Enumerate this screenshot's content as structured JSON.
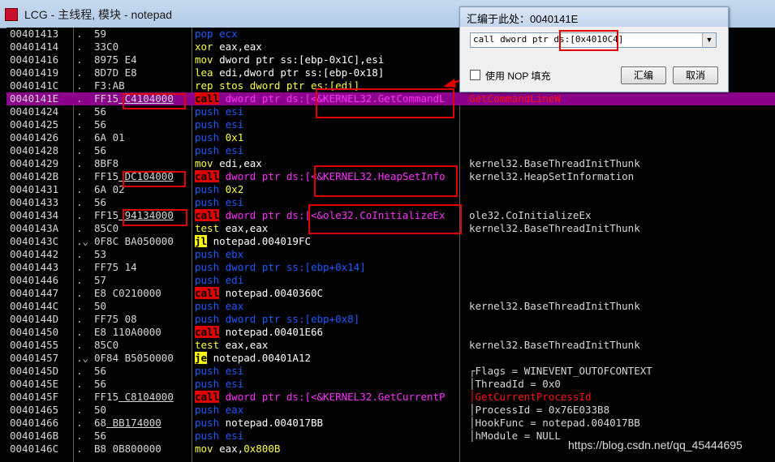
{
  "window": {
    "title": "LCG - 主线程, 模块 - notepad"
  },
  "rows": [
    {
      "addr": "00401413",
      "mark": ".",
      "hex": "59",
      "asm": [
        {
          "t": "pop ecx",
          "c": "k-blue"
        }
      ],
      "cmt": ""
    },
    {
      "addr": "00401414",
      "mark": ".",
      "hex": "33C0",
      "asm": [
        {
          "t": "xor ",
          "c": "k-yellow"
        },
        {
          "t": "eax,eax",
          "c": "k-white"
        }
      ],
      "cmt": ""
    },
    {
      "addr": "00401416",
      "mark": ".",
      "hex": "8975 E4",
      "asm": [
        {
          "t": "mov ",
          "c": "k-yellow"
        },
        {
          "t": "dword ptr ss:[ebp-0x1C],esi",
          "c": "k-white"
        }
      ],
      "cmt": ""
    },
    {
      "addr": "00401419",
      "mark": ".",
      "hex": "8D7D E8",
      "asm": [
        {
          "t": "lea ",
          "c": "k-yellow"
        },
        {
          "t": "edi,dword ptr ss:[ebp-0x18]",
          "c": "k-white"
        }
      ],
      "cmt": ""
    },
    {
      "addr": "0040141C",
      "mark": ".",
      "hex": "F3:AB",
      "asm": [
        {
          "t": "rep stos dword ptr es:[edi]",
          "c": "k-yellow"
        }
      ],
      "cmt": ""
    },
    {
      "addr": "0040141E",
      "mark": ".",
      "hex": "FF15 C4104000",
      "sel": true,
      "asm": [
        {
          "t": "call",
          "c": "k-call"
        },
        {
          "t": " dword ptr ds:[",
          "c": "k-mag"
        },
        {
          "t": "<&KERNEL32.GetCommandL",
          "c": "k-mag"
        }
      ],
      "cmt": "GetCommandLineW",
      "cmtc": "k-red"
    },
    {
      "addr": "00401424",
      "mark": ".",
      "hex": "56",
      "asm": [
        {
          "t": "push ",
          "c": "k-blue"
        },
        {
          "t": "esi",
          "c": "k-blue"
        }
      ],
      "cmt": ""
    },
    {
      "addr": "00401425",
      "mark": ".",
      "hex": "56",
      "asm": [
        {
          "t": "push ",
          "c": "k-blue"
        },
        {
          "t": "esi",
          "c": "k-blue"
        }
      ],
      "cmt": ""
    },
    {
      "addr": "00401426",
      "mark": ".",
      "hex": "6A 01",
      "asm": [
        {
          "t": "push ",
          "c": "k-blue"
        },
        {
          "t": "0x1",
          "c": "k-yellow"
        }
      ],
      "cmt": ""
    },
    {
      "addr": "00401428",
      "mark": ".",
      "hex": "56",
      "asm": [
        {
          "t": "push ",
          "c": "k-blue"
        },
        {
          "t": "esi",
          "c": "k-blue"
        }
      ],
      "cmt": ""
    },
    {
      "addr": "00401429",
      "mark": ".",
      "hex": "8BF8",
      "asm": [
        {
          "t": "mov ",
          "c": "k-yellow"
        },
        {
          "t": "edi,eax",
          "c": "k-white"
        }
      ],
      "cmt": "kernel32.BaseThreadInitThunk"
    },
    {
      "addr": "0040142B",
      "mark": ".",
      "hex": "FF15 DC104000",
      "asm": [
        {
          "t": "call",
          "c": "k-call"
        },
        {
          "t": " dword ptr ds:[",
          "c": "k-mag"
        },
        {
          "t": "<&KERNEL32.HeapSetInfo",
          "c": "k-mag"
        }
      ],
      "cmt": "kernel32.HeapSetInformation"
    },
    {
      "addr": "00401431",
      "mark": ".",
      "hex": "6A 02",
      "asm": [
        {
          "t": "push ",
          "c": "k-blue"
        },
        {
          "t": "0x2",
          "c": "k-yellow"
        }
      ],
      "cmt": ""
    },
    {
      "addr": "00401433",
      "mark": ".",
      "hex": "56",
      "asm": [
        {
          "t": "push ",
          "c": "k-blue"
        },
        {
          "t": "esi",
          "c": "k-blue"
        }
      ],
      "cmt": ""
    },
    {
      "addr": "00401434",
      "mark": ".",
      "hex": "FF15 94134000",
      "asm": [
        {
          "t": "call",
          "c": "k-call"
        },
        {
          "t": " dword ptr ds:[",
          "c": "k-mag"
        },
        {
          "t": "<&ole32.CoInitializeEx",
          "c": "k-mag"
        }
      ],
      "cmt": "ole32.CoInitializeEx"
    },
    {
      "addr": "0040143A",
      "mark": ".",
      "hex": "85C0",
      "asm": [
        {
          "t": "test ",
          "c": "k-yellow"
        },
        {
          "t": "eax,eax",
          "c": "k-white"
        }
      ],
      "cmt": "kernel32.BaseThreadInitThunk"
    },
    {
      "addr": "0040143C",
      "mark": ".⌄",
      "hex": "0F8C BA050000",
      "asm": [
        {
          "t": "jl",
          "c": "k-jmp"
        },
        {
          "t": " notepad.004019FC",
          "c": "k-white"
        }
      ],
      "cmt": ""
    },
    {
      "addr": "00401442",
      "mark": ".",
      "hex": "53",
      "asm": [
        {
          "t": "push ",
          "c": "k-blue"
        },
        {
          "t": "ebx",
          "c": "k-blue"
        }
      ],
      "cmt": ""
    },
    {
      "addr": "00401443",
      "mark": ".",
      "hex": "FF75 14",
      "asm": [
        {
          "t": "push ",
          "c": "k-blue"
        },
        {
          "t": "dword ptr ss:[ebp+0x14]",
          "c": "k-blue"
        }
      ],
      "cmt": ""
    },
    {
      "addr": "00401446",
      "mark": ".",
      "hex": "57",
      "asm": [
        {
          "t": "push ",
          "c": "k-blue"
        },
        {
          "t": "edi",
          "c": "k-blue"
        }
      ],
      "cmt": ""
    },
    {
      "addr": "00401447",
      "mark": ".",
      "hex": "E8 C0210000",
      "asm": [
        {
          "t": "call",
          "c": "k-call"
        },
        {
          "t": " notepad.0040360C",
          "c": "k-white"
        }
      ],
      "cmt": ""
    },
    {
      "addr": "0040144C",
      "mark": ".",
      "hex": "50",
      "asm": [
        {
          "t": "push ",
          "c": "k-blue"
        },
        {
          "t": "eax",
          "c": "k-blue"
        }
      ],
      "cmt": "kernel32.BaseThreadInitThunk"
    },
    {
      "addr": "0040144D",
      "mark": ".",
      "hex": "FF75 08",
      "asm": [
        {
          "t": "push ",
          "c": "k-blue"
        },
        {
          "t": "dword ptr ss:[ebp+0x8]",
          "c": "k-blue"
        }
      ],
      "cmt": ""
    },
    {
      "addr": "00401450",
      "mark": ".",
      "hex": "E8 110A0000",
      "asm": [
        {
          "t": "call",
          "c": "k-call"
        },
        {
          "t": " notepad.00401E66",
          "c": "k-white"
        }
      ],
      "cmt": ""
    },
    {
      "addr": "00401455",
      "mark": ".",
      "hex": "85C0",
      "asm": [
        {
          "t": "test ",
          "c": "k-yellow"
        },
        {
          "t": "eax,eax",
          "c": "k-white"
        }
      ],
      "cmt": "kernel32.BaseThreadInitThunk"
    },
    {
      "addr": "00401457",
      "mark": ".⌄",
      "hex": "0F84 B5050000",
      "asm": [
        {
          "t": "je",
          "c": "k-jmp"
        },
        {
          "t": " notepad.00401A12",
          "c": "k-white"
        }
      ],
      "cmt": ""
    },
    {
      "addr": "0040145D",
      "mark": ".",
      "hex": "56",
      "asm": [
        {
          "t": "push ",
          "c": "k-blue"
        },
        {
          "t": "esi",
          "c": "k-blue"
        }
      ],
      "cmt": "┌Flags = WINEVENT_OUTOFCONTEXT"
    },
    {
      "addr": "0040145E",
      "mark": ".",
      "hex": "56",
      "asm": [
        {
          "t": "push ",
          "c": "k-blue"
        },
        {
          "t": "esi",
          "c": "k-blue"
        }
      ],
      "cmt": "│ThreadId = 0x0"
    },
    {
      "addr": "0040145F",
      "mark": ".",
      "hex": "FF15 C8104000",
      "asm": [
        {
          "t": "call",
          "c": "k-call"
        },
        {
          "t": " dword ptr ds:[",
          "c": "k-mag"
        },
        {
          "t": "<&KERNEL32.GetCurrentP",
          "c": "k-mag"
        }
      ],
      "cmt": "│GetCurrentProcessId",
      "cmtc": "k-red"
    },
    {
      "addr": "00401465",
      "mark": ".",
      "hex": "50",
      "asm": [
        {
          "t": "push ",
          "c": "k-blue"
        },
        {
          "t": "eax",
          "c": "k-blue"
        }
      ],
      "cmt": "│ProcessId = 0x76E033B8"
    },
    {
      "addr": "00401466",
      "mark": ".",
      "hex": "68 BB174000",
      "asm": [
        {
          "t": "push ",
          "c": "k-blue"
        },
        {
          "t": "notepad.004017BB",
          "c": "k-white"
        }
      ],
      "cmt": "│HookFunc = notepad.004017BB"
    },
    {
      "addr": "0040146B",
      "mark": ".",
      "hex": "56",
      "asm": [
        {
          "t": "push ",
          "c": "k-blue"
        },
        {
          "t": "esi",
          "c": "k-blue"
        }
      ],
      "cmt": "│hModule = NULL"
    },
    {
      "addr": "0040146C",
      "mark": ".",
      "hex": "B8 0B800000",
      "asm": [
        {
          "t": "mov ",
          "c": "k-yellow"
        },
        {
          "t": "eax,",
          "c": "k-white"
        },
        {
          "t": "0x800B",
          "c": "k-yellow"
        }
      ],
      "cmt": ""
    }
  ],
  "dialog": {
    "title": "汇编于此处：0040141E",
    "instruction": "call dword ptr ds:[0x4010C4]",
    "nop_label": "使用 NOP 填充",
    "assemble_button": "汇编",
    "cancel_button": "取消"
  },
  "watermark": "https://blog.csdn.net/qq_45444695",
  "colors": {
    "selected_row": "#8a008a",
    "call_bg": "#e00000",
    "jump_bg": "#ffff00",
    "annotation_box": "#e00000"
  }
}
